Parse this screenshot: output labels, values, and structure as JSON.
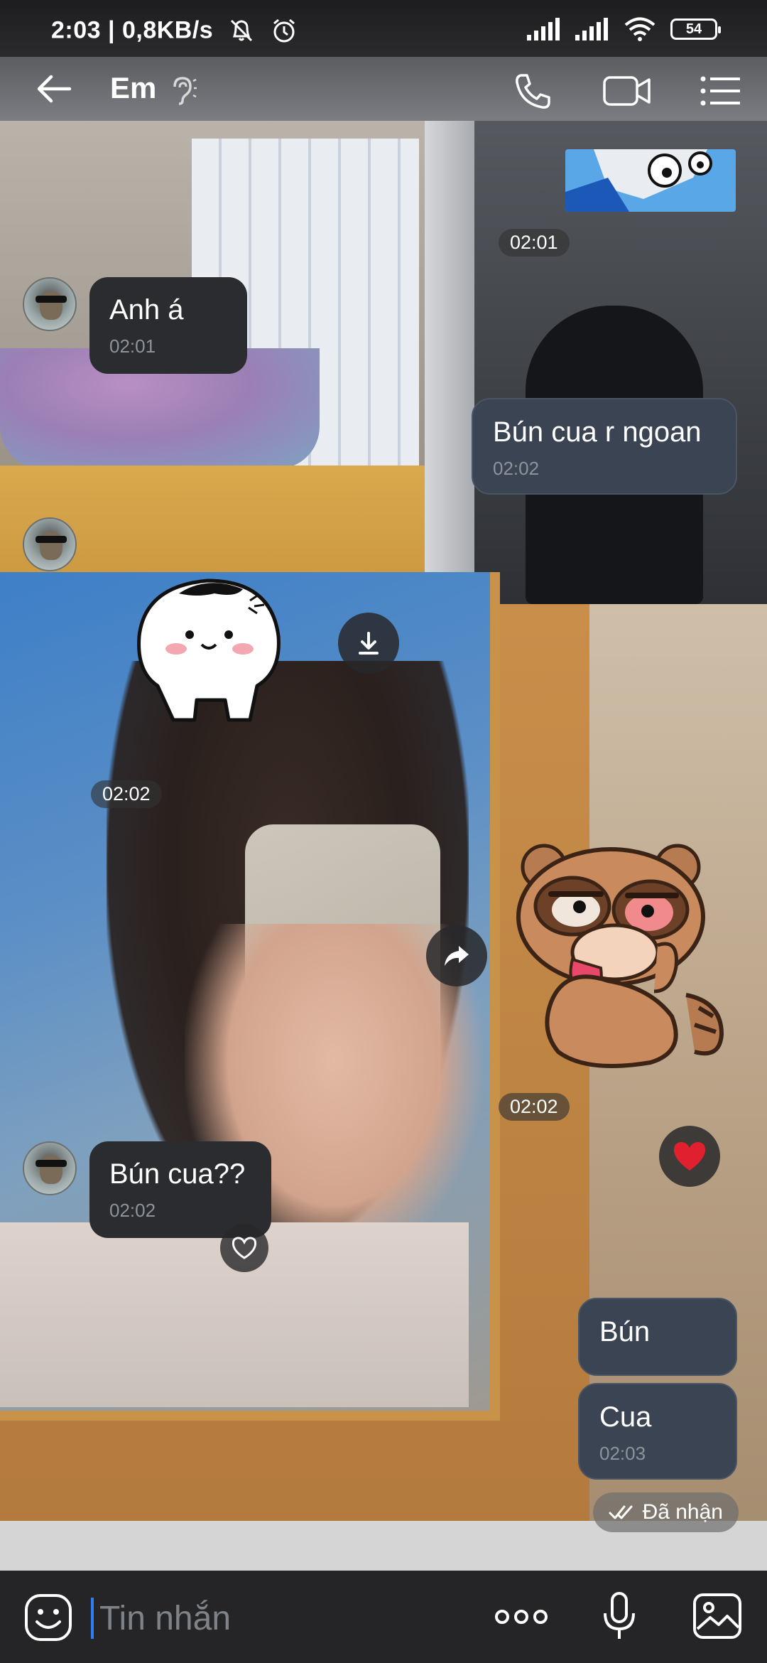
{
  "status_bar": {
    "time": "2:03",
    "speed": "| 0,8KB/s",
    "battery": "54"
  },
  "header": {
    "title": "Em"
  },
  "messages": [
    {
      "id": "m1",
      "direction": "in",
      "text": "Anh á",
      "time": "02:01"
    },
    {
      "id": "m2",
      "direction": "out",
      "text": "Bún cua r ngoan",
      "time": "02:02"
    },
    {
      "id": "m3",
      "direction": "in",
      "text": "Bún cua??",
      "time": "02:02"
    },
    {
      "id": "m4",
      "direction": "out",
      "text": "Bún",
      "time": ""
    },
    {
      "id": "m5",
      "direction": "out",
      "text": "Cua",
      "time": "02:03"
    }
  ],
  "time_chips": {
    "photo_top": "02:01",
    "sticker_left": "02:02",
    "sticker_right": "02:02"
  },
  "received_status": "Đã nhận",
  "input": {
    "placeholder": "Tin nhắn"
  },
  "colors": {
    "incoming_bubble": "#2b2c2f",
    "outgoing_bubble": "#3b4453",
    "caret": "#2f7df6",
    "heart": "#e0202f"
  }
}
